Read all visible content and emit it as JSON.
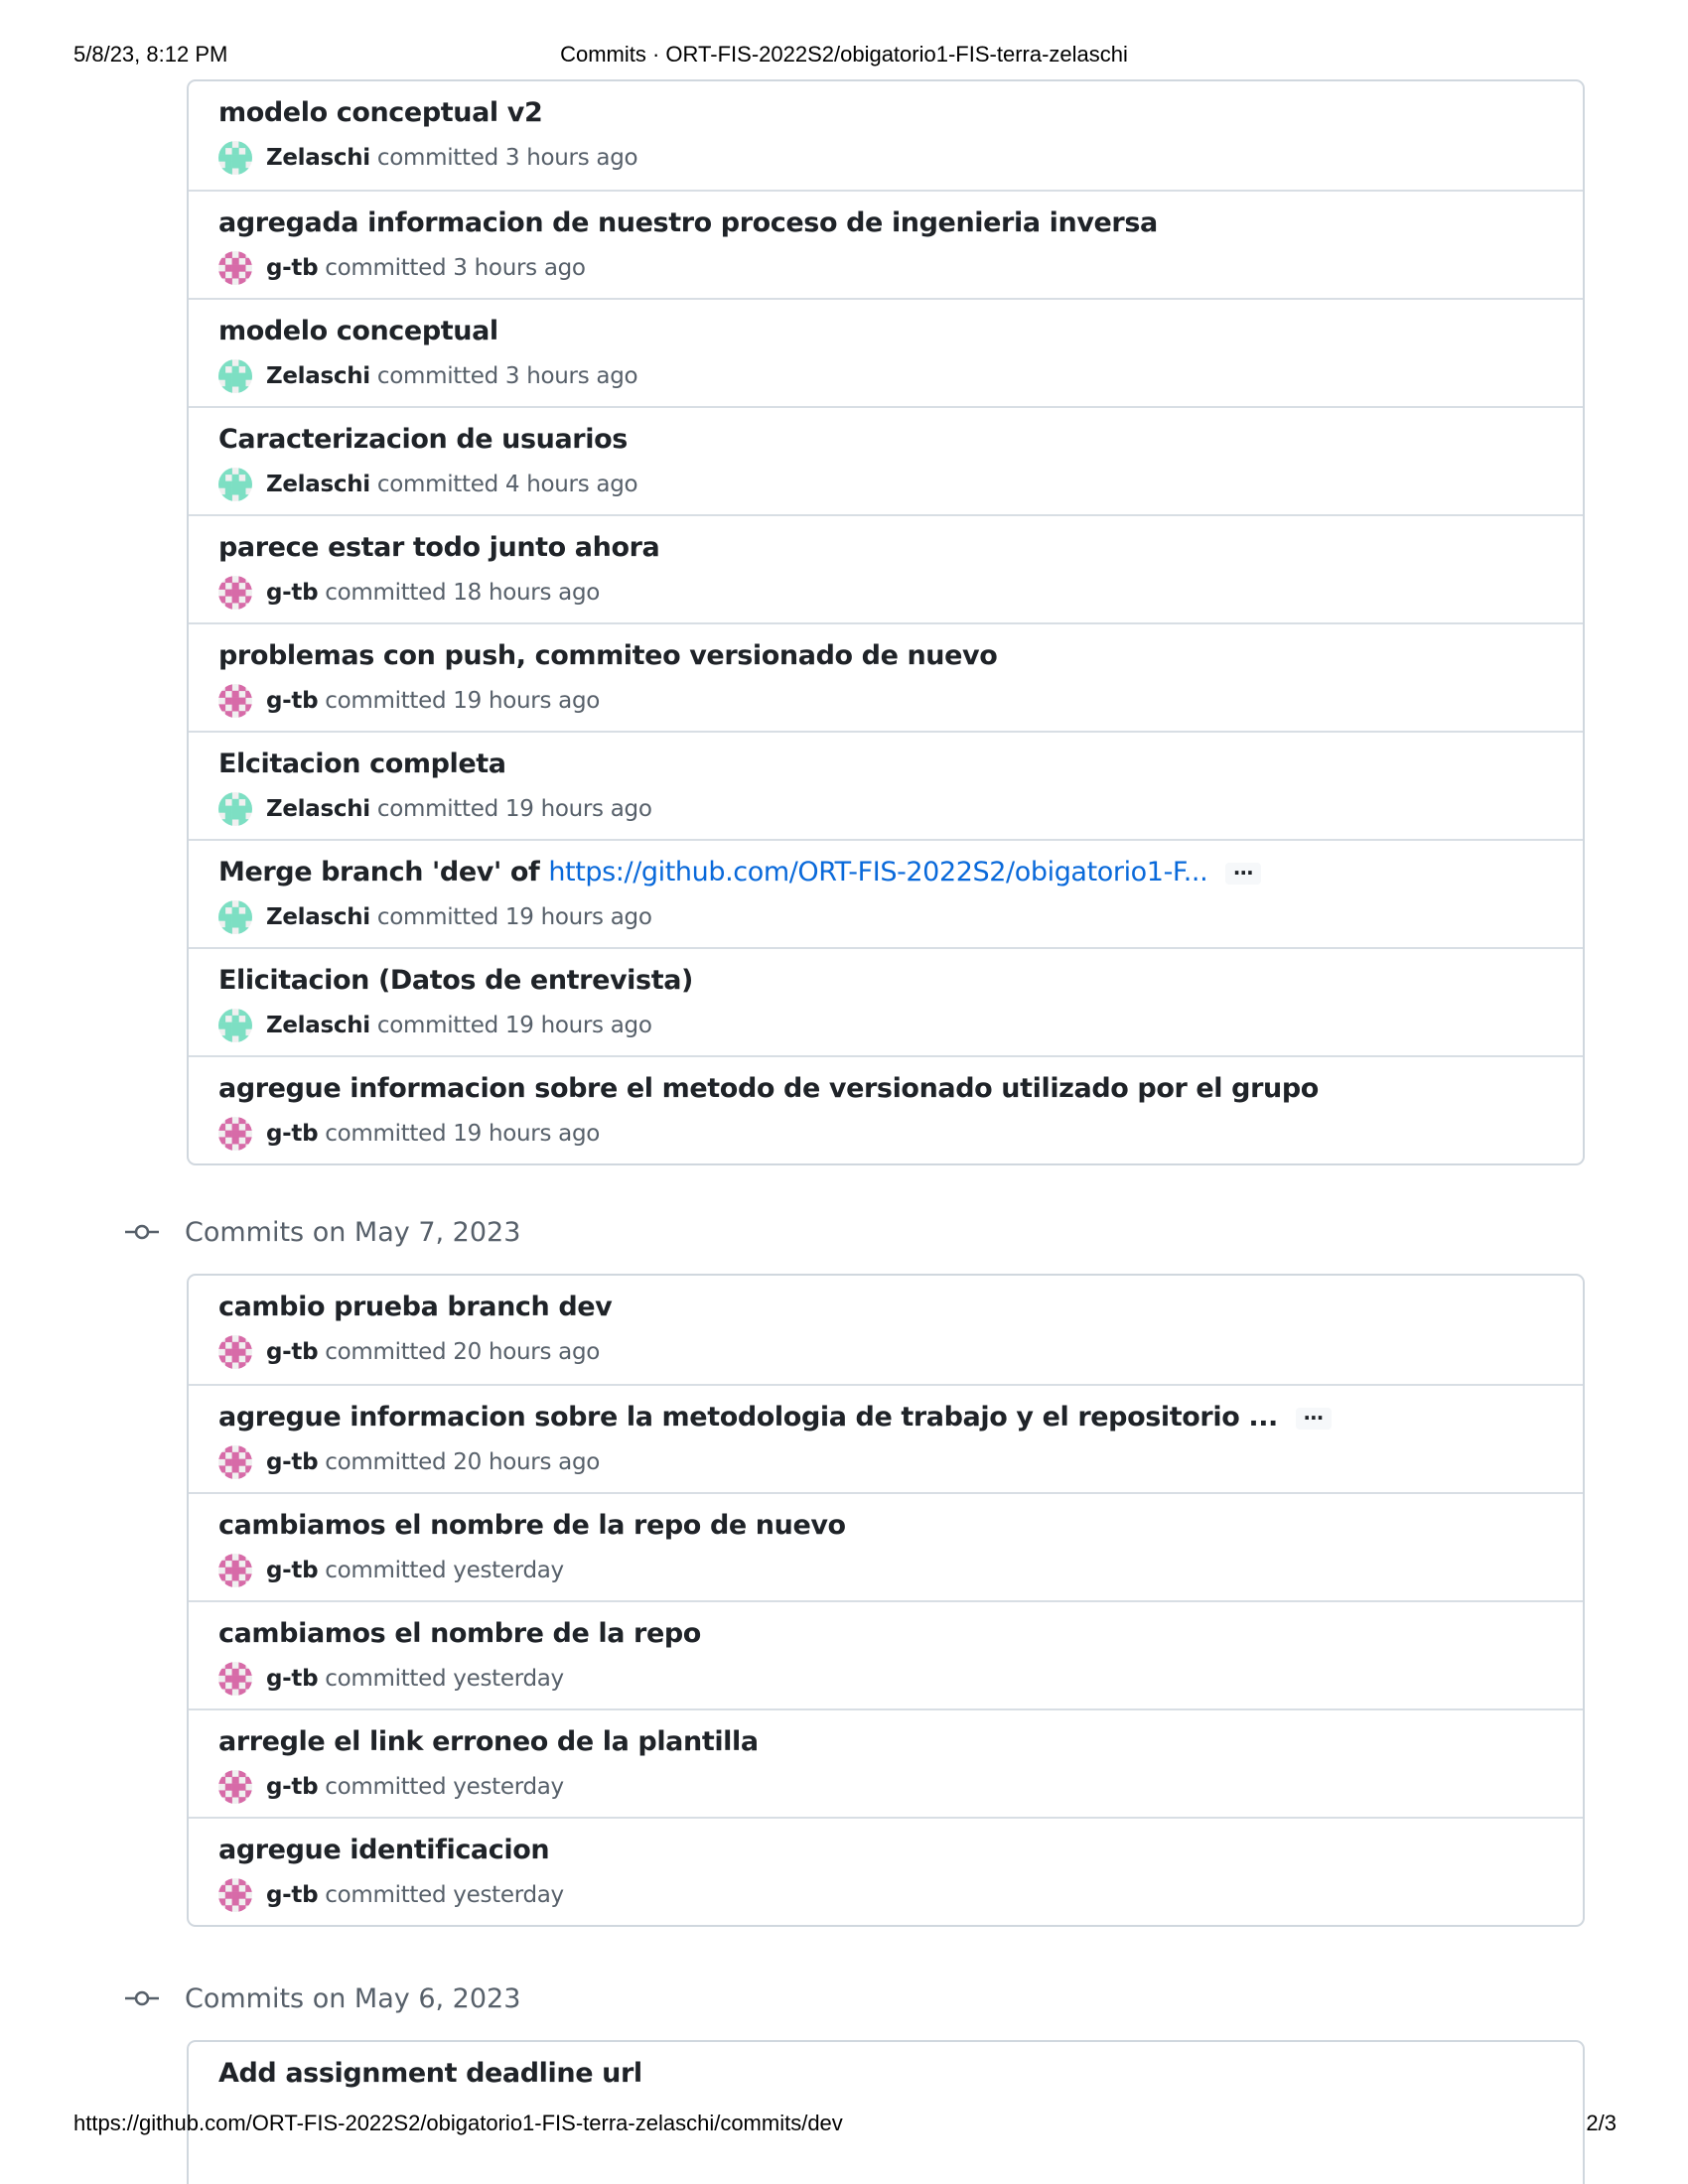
{
  "print_header": {
    "datetime": "5/8/23, 8:12 PM",
    "page_title": "Commits · ORT-FIS-2022S2/obigatorio1-FIS-terra-zelaschi"
  },
  "print_footer": {
    "url": "https://github.com/ORT-FIS-2022S2/obigatorio1-FIS-terra-zelaschi/commits/dev",
    "page_number": "2/3"
  },
  "colors": {
    "zelaschi_avatar": "#7ddfc3",
    "gtb_avatar": "#d76ba8",
    "link": "#0969da"
  },
  "verb": "committed",
  "groups": [
    {
      "header": "",
      "commits": [
        {
          "title": "modelo conceptual v2",
          "author": "Zelaschi",
          "time": "3 hours ago",
          "avatar": "zelaschi"
        },
        {
          "title": "agregada informacion de nuestro proceso de ingenieria inversa",
          "author": "g-tb",
          "time": "3 hours ago",
          "avatar": "gtb"
        },
        {
          "title": "modelo conceptual",
          "author": "Zelaschi",
          "time": "3 hours ago",
          "avatar": "zelaschi"
        },
        {
          "title": "Caracterizacion de usuarios",
          "author": "Zelaschi",
          "time": "4 hours ago",
          "avatar": "zelaschi"
        },
        {
          "title": "parece estar todo junto ahora",
          "author": "g-tb",
          "time": "18 hours ago",
          "avatar": "gtb"
        },
        {
          "title": "problemas con push, commiteo versionado de nuevo",
          "author": "g-tb",
          "time": "19 hours ago",
          "avatar": "gtb"
        },
        {
          "title": "Elcitacion completa",
          "author": "Zelaschi",
          "time": "19 hours ago",
          "avatar": "zelaschi"
        },
        {
          "title": "Merge branch 'dev' of ",
          "link": "https://github.com/ORT-FIS-2022S2/obigatorio1-F...",
          "ellipsis": "…",
          "author": "Zelaschi",
          "time": "19 hours ago",
          "avatar": "zelaschi"
        },
        {
          "title": "Elicitacion (Datos de entrevista)",
          "author": "Zelaschi",
          "time": "19 hours ago",
          "avatar": "zelaschi"
        },
        {
          "title": "agregue informacion sobre el metodo de versionado utilizado por el grupo",
          "author": "g-tb",
          "time": "19 hours ago",
          "avatar": "gtb"
        }
      ]
    },
    {
      "header": "Commits on May 7, 2023",
      "commits": [
        {
          "title": "cambio prueba branch dev",
          "author": "g-tb",
          "time": "20 hours ago",
          "avatar": "gtb"
        },
        {
          "title": "agregue informacion sobre la metodologia de trabajo y el repositorio ...",
          "ellipsis": "…",
          "author": "g-tb",
          "time": "20 hours ago",
          "avatar": "gtb"
        },
        {
          "title": "cambiamos el nombre de la repo de nuevo",
          "author": "g-tb",
          "time": "yesterday",
          "avatar": "gtb"
        },
        {
          "title": "cambiamos el nombre de la repo",
          "author": "g-tb",
          "time": "yesterday",
          "avatar": "gtb"
        },
        {
          "title": "arregle el link erroneo de la plantilla",
          "author": "g-tb",
          "time": "yesterday",
          "avatar": "gtb"
        },
        {
          "title": "agregue identificacion",
          "author": "g-tb",
          "time": "yesterday",
          "avatar": "gtb"
        }
      ]
    },
    {
      "header": "Commits on May 6, 2023",
      "commits": [
        {
          "title": "Add assignment deadline url",
          "author": "",
          "time": "",
          "avatar": ""
        }
      ]
    }
  ]
}
